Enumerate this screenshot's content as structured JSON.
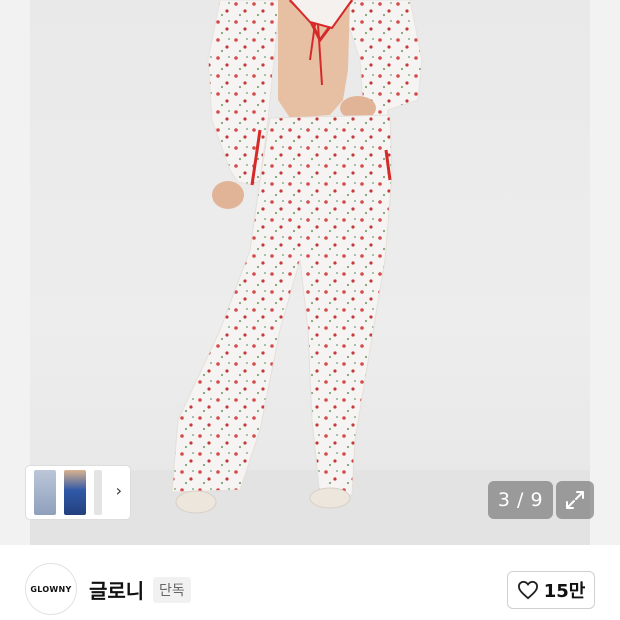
{
  "product_image": {
    "description_icon": "product-photo",
    "thumbnails": [
      "thumb-jeans",
      "thumb-outfit",
      "thumb-more"
    ],
    "counter": "3 / 9"
  },
  "brand": {
    "logo_text": "GLOWNY",
    "name": "글로니",
    "badge": "단독",
    "like_count": "15만"
  },
  "colors": {
    "accent": "#d62a2a",
    "pager_bg": "#6e6e6e"
  }
}
